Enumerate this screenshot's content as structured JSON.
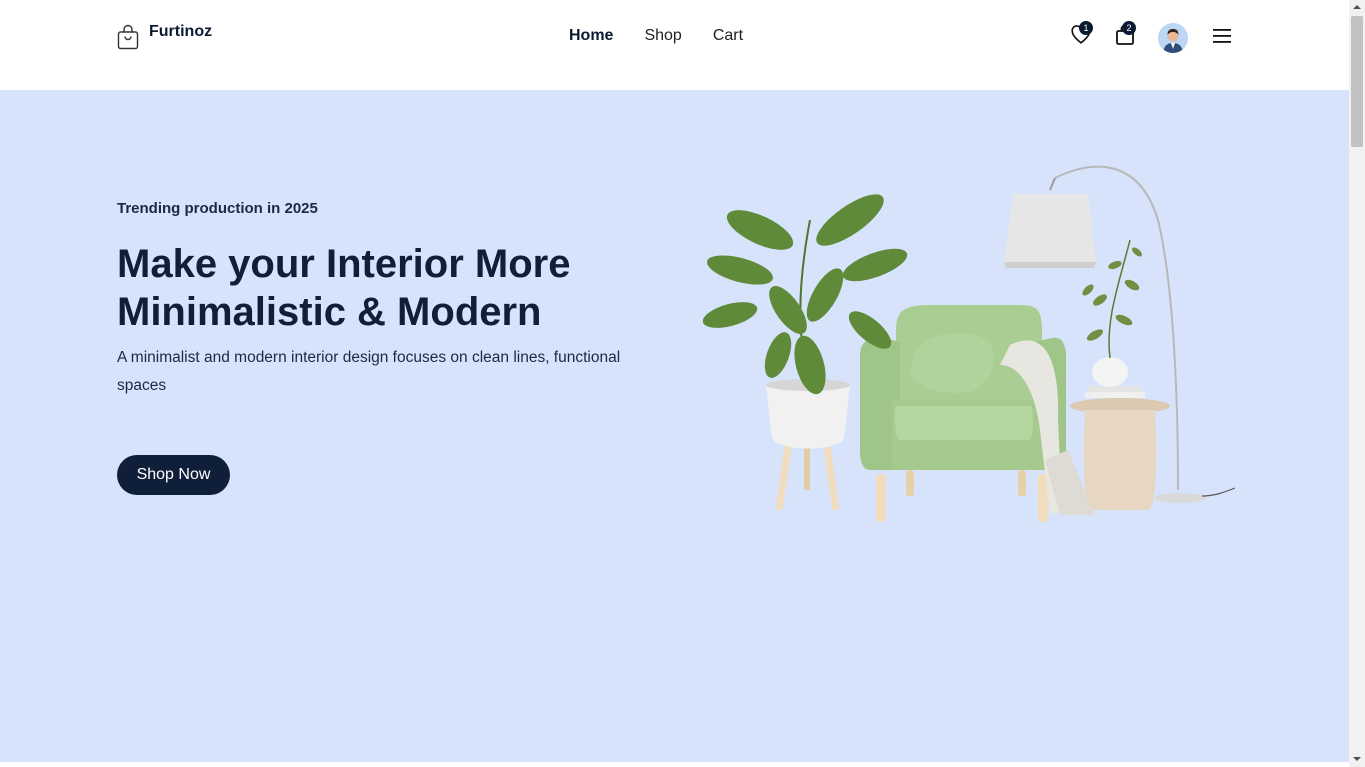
{
  "brand": {
    "name": "Furtinoz"
  },
  "nav": {
    "home": "Home",
    "shop": "Shop",
    "cart": "Cart"
  },
  "header_actions": {
    "wishlist_count": "1",
    "cart_count": "2"
  },
  "hero": {
    "eyebrow": "Trending production in 2025",
    "headline": "Make your Interior More Minimalistic & Modern",
    "subtext": "A minimalist and modern interior design focuses on clean lines, functional spaces",
    "cta_label": "Shop Now"
  },
  "icons": {
    "logo": "shopping-bag-icon",
    "wishlist": "heart-icon",
    "cart": "bag-icon",
    "avatar": "user-avatar",
    "menu": "hamburger-icon"
  },
  "colors": {
    "hero_bg": "#d6e3fa",
    "primary_dark": "#0f1f3a",
    "chair_green": "#a3c98c"
  }
}
